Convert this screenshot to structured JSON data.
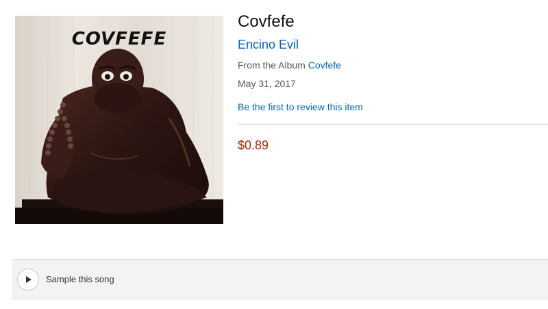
{
  "album_art": {
    "cover_text": "COVFEFE",
    "depicts": "figurine-icon"
  },
  "product": {
    "title": "Covfefe",
    "artist": "Encino Evil",
    "from_album_prefix": "From the Album ",
    "album_link": "Covfefe",
    "release_date": "May 31, 2017",
    "review_link": "Be the first to review this item",
    "price": "$0.89"
  },
  "sample": {
    "play_icon": "play-icon",
    "label": "Sample this song"
  },
  "colors": {
    "link": "#0066c0",
    "price": "#b12704",
    "muted_text": "#565959",
    "sample_bar_bg": "#f3f3f3"
  }
}
